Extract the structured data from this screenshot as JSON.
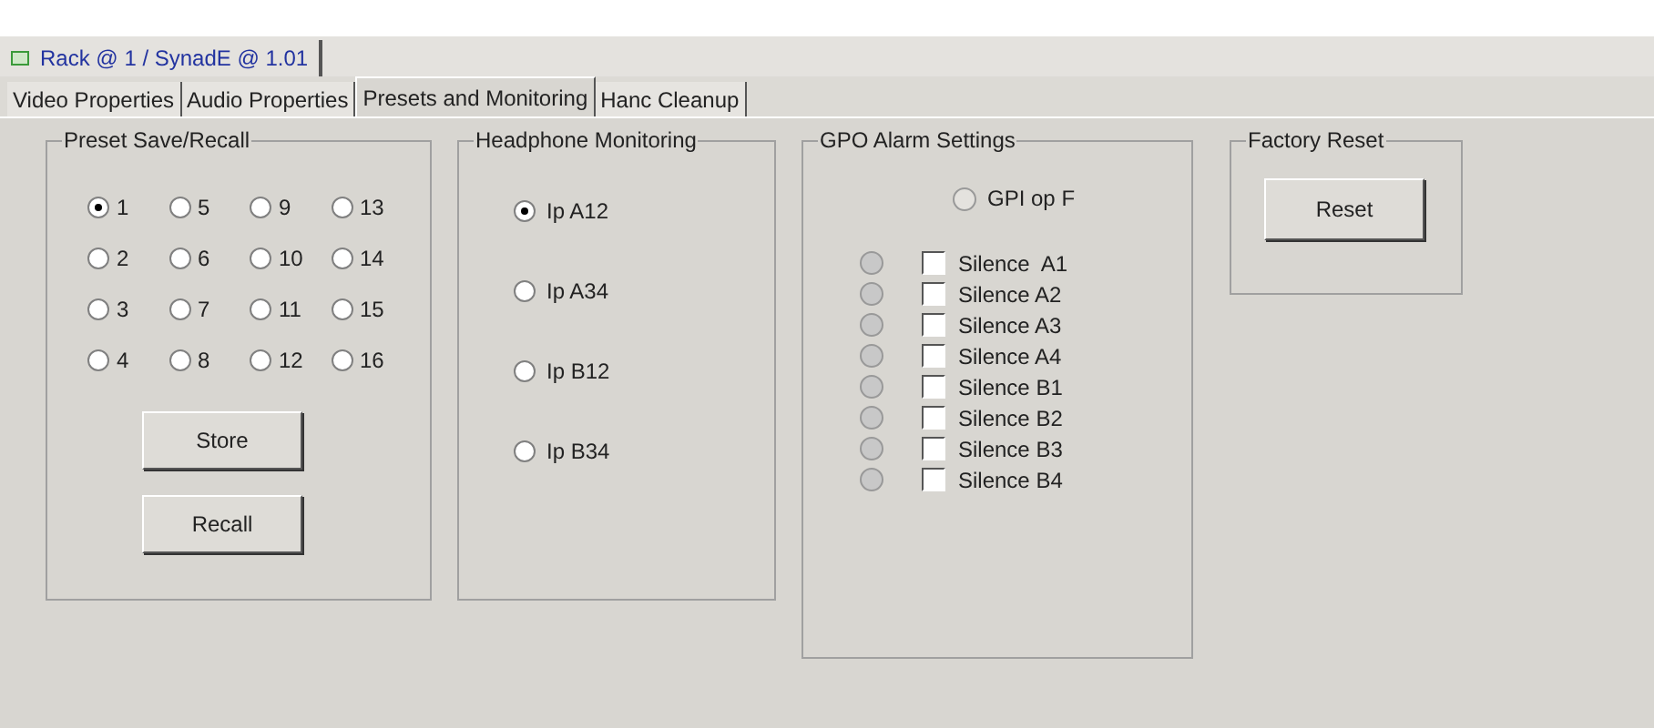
{
  "device_tab": {
    "label": "Rack @ 1 / SynadE @ 1.01"
  },
  "tabs": [
    {
      "label": "Video Properties",
      "selected": false
    },
    {
      "label": "Audio Properties",
      "selected": false
    },
    {
      "label": "Presets and Monitoring",
      "selected": true
    },
    {
      "label": "Hanc Cleanup",
      "selected": false
    }
  ],
  "preset_group": {
    "title": "Preset Save/Recall",
    "presets": [
      {
        "label": "1",
        "selected": true
      },
      {
        "label": "5",
        "selected": false
      },
      {
        "label": "9",
        "selected": false
      },
      {
        "label": "13",
        "selected": false
      },
      {
        "label": "2",
        "selected": false
      },
      {
        "label": "6",
        "selected": false
      },
      {
        "label": "10",
        "selected": false
      },
      {
        "label": "14",
        "selected": false
      },
      {
        "label": "3",
        "selected": false
      },
      {
        "label": "7",
        "selected": false
      },
      {
        "label": "11",
        "selected": false
      },
      {
        "label": "15",
        "selected": false
      },
      {
        "label": "4",
        "selected": false
      },
      {
        "label": "8",
        "selected": false
      },
      {
        "label": "12",
        "selected": false
      },
      {
        "label": "16",
        "selected": false
      }
    ],
    "buttons": [
      "Store",
      "Recall"
    ]
  },
  "headphone_group": {
    "title": "Headphone Monitoring",
    "options": [
      {
        "label": "Ip A12",
        "selected": true
      },
      {
        "label": "Ip A34",
        "selected": false
      },
      {
        "label": "Ip B12",
        "selected": false
      },
      {
        "label": "Ip B34",
        "selected": false
      }
    ]
  },
  "gpo_group": {
    "title": "GPO Alarm Settings",
    "gpi": {
      "label": "GPI op F"
    },
    "alarms": [
      {
        "label": "Silence  A1",
        "checked": false
      },
      {
        "label": "Silence A2",
        "checked": false
      },
      {
        "label": "Silence A3",
        "checked": false
      },
      {
        "label": "Silence A4",
        "checked": false
      },
      {
        "label": "Silence B1",
        "checked": false
      },
      {
        "label": "Silence B2",
        "checked": false
      },
      {
        "label": "Silence B3",
        "checked": false
      },
      {
        "label": "Silence B4",
        "checked": false
      }
    ]
  },
  "factory_group": {
    "title": "Factory Reset",
    "button": "Reset"
  }
}
